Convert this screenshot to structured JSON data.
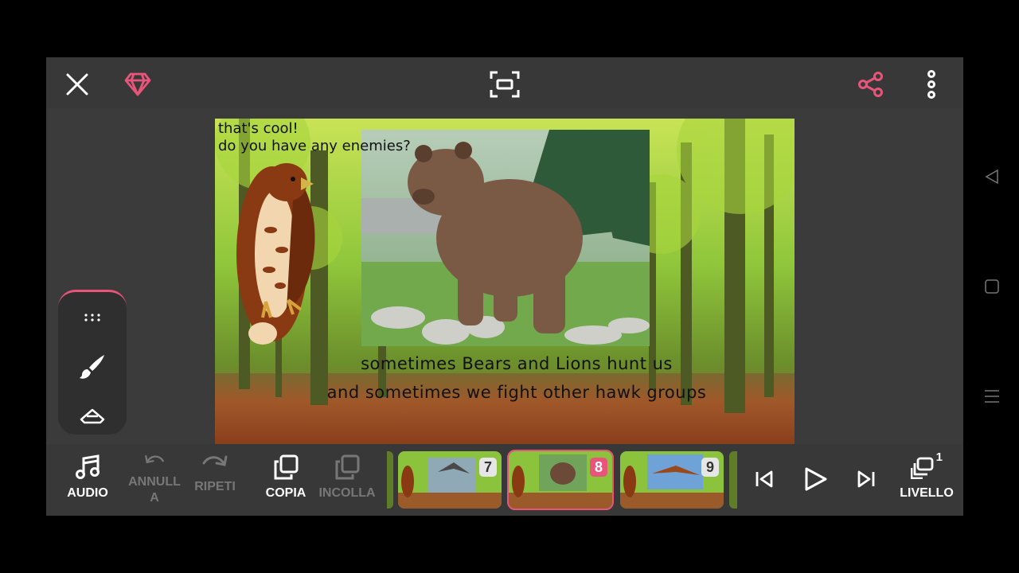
{
  "stage": {
    "caption_top_line1": "that's cool!",
    "caption_top_line2": "do you have any enemies?",
    "caption_bottom_line1": "sometimes Bears and Lions hunt us",
    "caption_bottom_line2": "and sometimes we fight other hawk groups"
  },
  "toolbar_bottom": {
    "audio_label": "AUDIO",
    "undo_label": "ANNULL A",
    "redo_label": "RIPETI",
    "copy_label": "COPIA",
    "paste_label": "INCOLLA",
    "layer_label": "LIVELLO",
    "layer_count": "1"
  },
  "frames": [
    {
      "number": "7",
      "selected": false
    },
    {
      "number": "8",
      "selected": true
    },
    {
      "number": "9",
      "selected": false
    }
  ],
  "colors": {
    "accent": "#e8547a",
    "background": "#3b3b3b",
    "bar": "#383838"
  },
  "icons": {
    "close": "close-icon",
    "premium": "diamond-icon",
    "fit_screen": "fit-screen-icon",
    "share": "share-icon",
    "more": "more-vertical-icon",
    "audio": "music-note-icon",
    "undo": "undo-icon",
    "redo": "redo-icon",
    "copy": "copy-icon",
    "paste": "paste-icon",
    "prev_frame": "skip-previous-icon",
    "play": "play-icon",
    "next_frame": "skip-next-icon",
    "layer": "layers-icon",
    "grip": "grip-icon",
    "brush": "brush-icon",
    "eraser": "eraser-icon"
  }
}
